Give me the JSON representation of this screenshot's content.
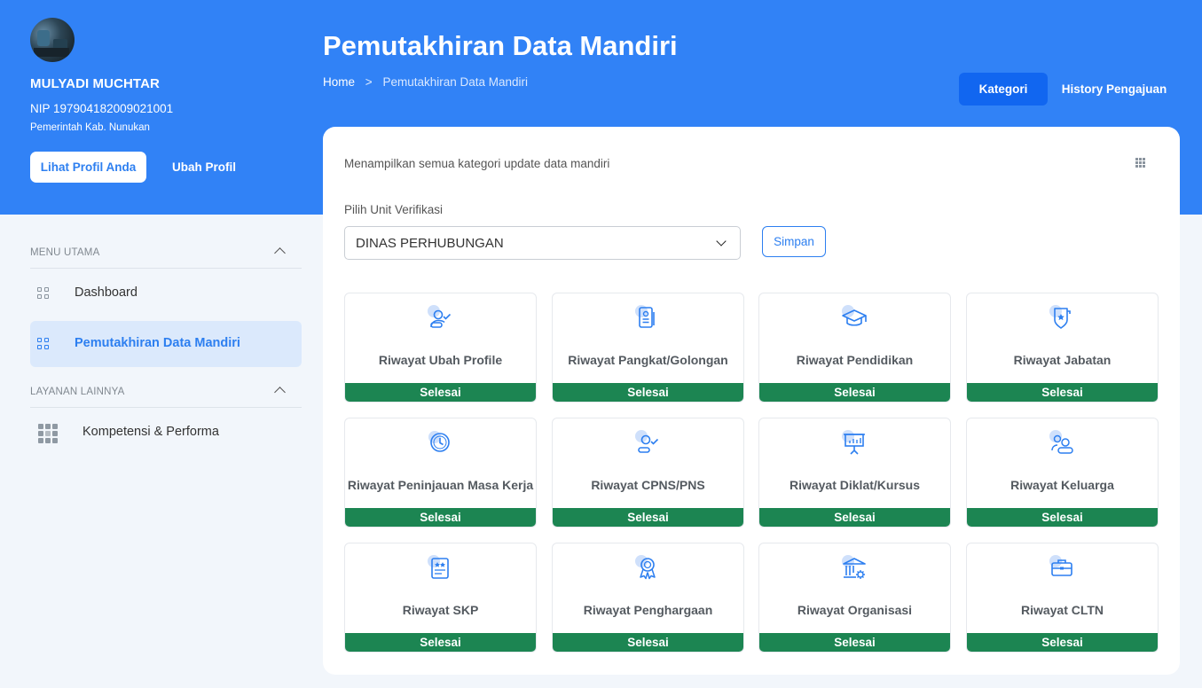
{
  "profile": {
    "name": "MULYADI MUCHTAR",
    "nip": "NIP 197904182009021001",
    "organization": "Pemerintah Kab. Nunukan",
    "view_profile_label": "Lihat Profil Anda",
    "edit_profile_label": "Ubah Profil"
  },
  "sidebar": {
    "sections": [
      {
        "title": "MENU UTAMA",
        "items": [
          {
            "label": "Dashboard",
            "icon": "grid-icon",
            "active": false
          },
          {
            "label": "Pemutakhiran Data Mandiri",
            "icon": "grid-icon",
            "active": true
          }
        ]
      },
      {
        "title": "LAYANAN LAINNYA",
        "items": [
          {
            "label": "Kompetensi & Performa",
            "icon": "apps-grid-icon",
            "active": false
          }
        ]
      }
    ]
  },
  "header": {
    "title": "Pemutakhiran Data Mandiri",
    "breadcrumb": {
      "home": "Home",
      "separator": ">",
      "current": "Pemutakhiran Data Mandiri"
    },
    "tabs": [
      {
        "label": "Kategori",
        "active": true
      },
      {
        "label": "History Pengajuan",
        "active": false
      }
    ]
  },
  "main": {
    "description": "Menampilkan semua kategori update data mandiri",
    "unit_label": "Pilih Unit Verifikasi",
    "unit_selected": "DINAS PERHUBUNGAN",
    "save_label": "Simpan",
    "categories": [
      {
        "title": "Riwayat Ubah Profile",
        "status": "Selesai",
        "icon": "user-check-icon"
      },
      {
        "title": "Riwayat Pangkat/Golongan",
        "status": "Selesai",
        "icon": "id-card-icon"
      },
      {
        "title": "Riwayat Pendidikan",
        "status": "Selesai",
        "icon": "graduation-cap-icon"
      },
      {
        "title": "Riwayat Jabatan",
        "status": "Selesai",
        "icon": "badge-shield-icon"
      },
      {
        "title": "Riwayat Peninjauan Masa Kerja",
        "status": "Selesai",
        "icon": "clock-icon"
      },
      {
        "title": "Riwayat CPNS/PNS",
        "status": "Selesai",
        "icon": "user-check-icon"
      },
      {
        "title": "Riwayat Diklat/Kursus",
        "status": "Selesai",
        "icon": "presentation-board-icon"
      },
      {
        "title": "Riwayat Keluarga",
        "status": "Selesai",
        "icon": "family-users-icon"
      },
      {
        "title": "Riwayat SKP",
        "status": "Selesai",
        "icon": "certificate-icon"
      },
      {
        "title": "Riwayat Penghargaan",
        "status": "Selesai",
        "icon": "award-ribbon-icon"
      },
      {
        "title": "Riwayat Organisasi",
        "status": "Selesai",
        "icon": "building-gear-icon"
      },
      {
        "title": "Riwayat CLTN",
        "status": "Selesai",
        "icon": "briefcase-icon"
      }
    ]
  },
  "colors": {
    "brand": "#3182f6",
    "active_tab": "#1166f0",
    "status_done": "#1c8552",
    "sidebar_active_bg": "#dbe9fc",
    "icon_accent": "#2d7ff0"
  }
}
